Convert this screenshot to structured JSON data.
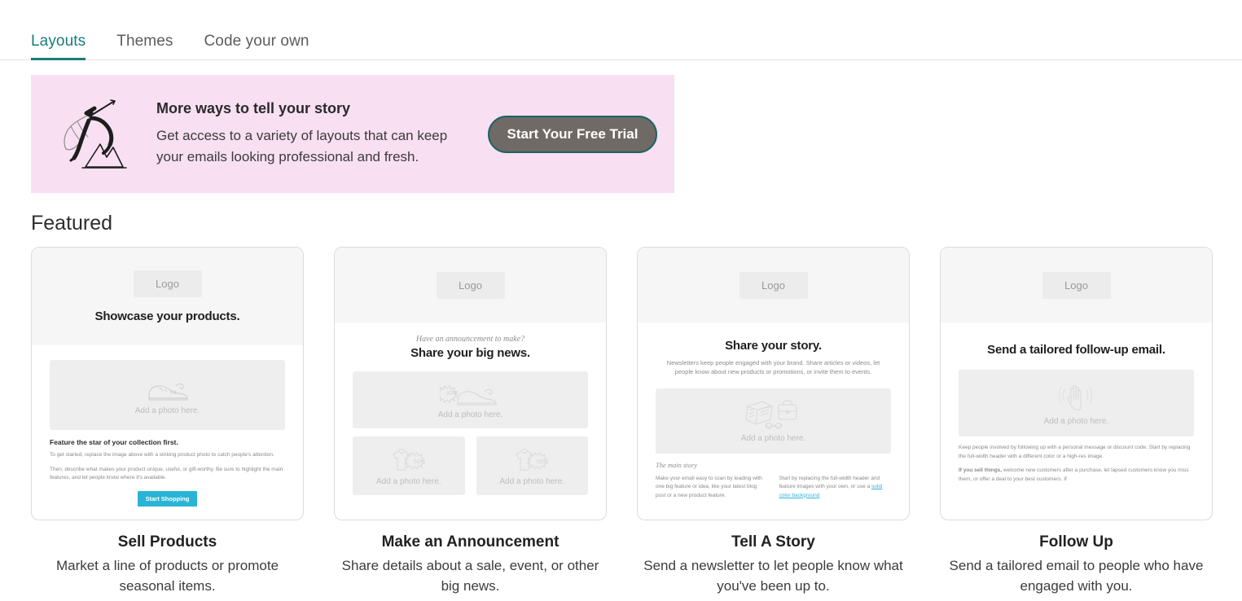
{
  "tabs": [
    {
      "label": "Layouts",
      "active": true
    },
    {
      "label": "Themes",
      "active": false
    },
    {
      "label": "Code your own",
      "active": false
    }
  ],
  "promo": {
    "title": "More ways to tell your story",
    "body": "Get access to a variety of layouts that can keep your emails looking professional and fresh.",
    "cta_label": "Start Your Free Trial",
    "background_color": "#f8dff2",
    "cta_background_color": "#6f6a66",
    "cta_border_color": "#1a6464",
    "illustration": "caped-person-leaping-over-mountains-illustration"
  },
  "section": {
    "featured_heading": "Featured"
  },
  "cards": [
    {
      "caption_title": "Sell Products",
      "caption_desc": "Market a line of products or promote seasonal items.",
      "logo_label": "Logo",
      "headline": "Showcase your products.",
      "photo_label": "Add a photo here.",
      "photo_icon": "shoe-icon",
      "body_heading": "Feature the star of your collection first.",
      "body_p1": "To get started, replace the image above with a striking product photo to catch people's attention.",
      "body_p2": "Then, describe what makes your product unique, useful, or gift-worthy. Be sure to highlight the main features, and let people know where it's available.",
      "button_label": "Start Shopping",
      "button_color": "#29b4d6"
    },
    {
      "caption_title": "Make an Announcement",
      "caption_desc": "Share details about a sale, event, or other big news.",
      "logo_label": "Logo",
      "eyebrow": "Have an announcement to make?",
      "headline": "Share your big news.",
      "photo_label": "Add a photo here.",
      "photo_icon": "shoe-discount-icon",
      "photo_label_left": "Add a photo here.",
      "photo_label_right": "Add a photo here.",
      "photo_icon_left": "tshirt-50-percent-icon",
      "photo_icon_right": "tshirt-50-percent-icon"
    },
    {
      "caption_title": "Tell A Story",
      "caption_desc": "Send a newsletter to let people know what you've been up to.",
      "logo_label": "Logo",
      "headline": "Share your story.",
      "subhead": "Newsletters keep people engaged with your brand. Share articles or videos, let people know about new products or promotions, or invite them to events.",
      "photo_label": "Add a photo here.",
      "photo_icon": "newspaper-and-briefcase-icon",
      "story_label": "The main story",
      "col_left": "Make your email easy to scan by leading with one big feature or idea, like your latest blog post or a new product feature.",
      "col_right_before": "Start by replacing the full-width header and feature images with your own, or use a ",
      "col_right_link": "solid color background",
      "link_color": "#2fb6d8"
    },
    {
      "caption_title": "Follow Up",
      "caption_desc": "Send a tailored email to people who have engaged with you.",
      "logo_label": "Logo",
      "headline": "Send a tailored follow-up email.",
      "photo_label": "Add a photo here.",
      "photo_icon": "waving-hand-icon",
      "body_p1": "Keep people involved by following up with a personal message or discount code. Start by replacing the full-width header with a different color or a high-res image.",
      "body_p2_bold": "If you sell things,",
      "body_p2": " welcome new customers after a purchase, let lapsed customers know you miss them, or offer a deal to your best customers. If"
    }
  ]
}
